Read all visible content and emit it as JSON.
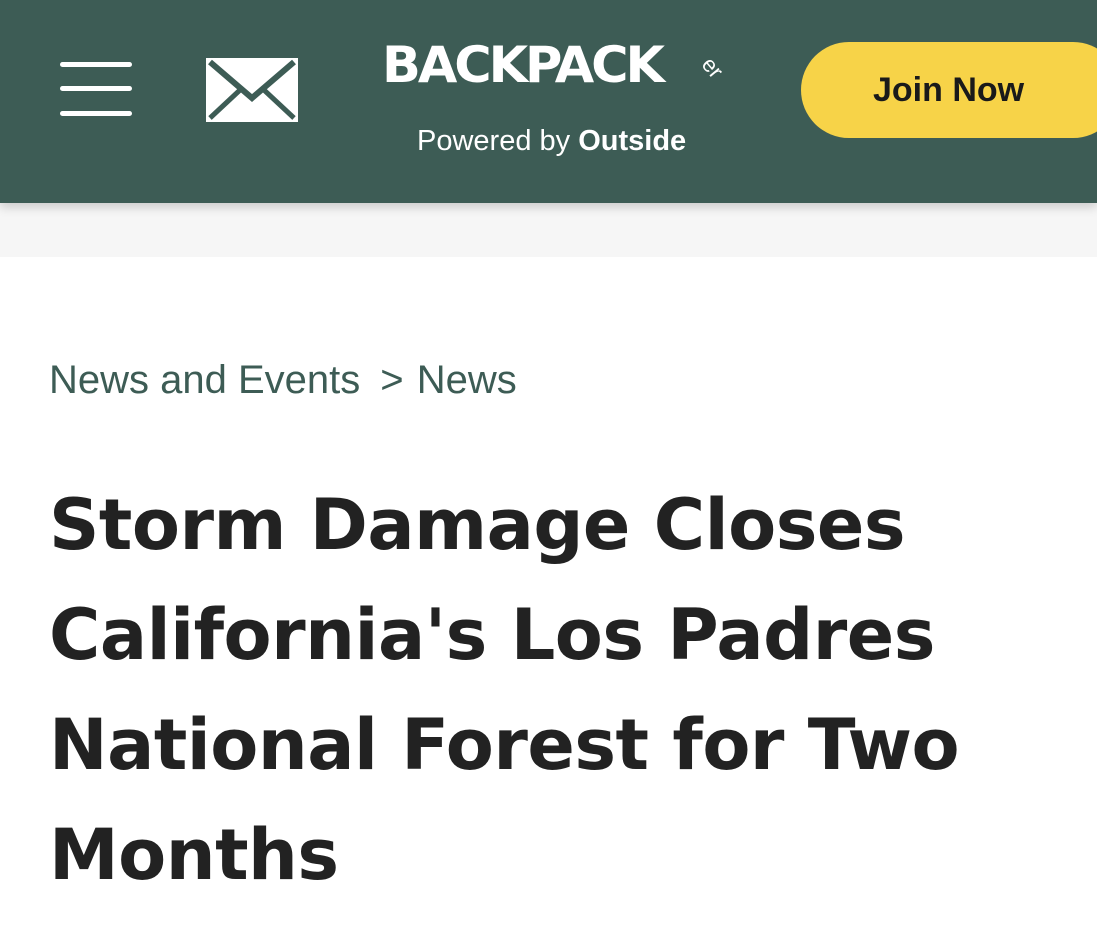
{
  "header": {
    "logo_text": "BACKPACK",
    "logo_suffix": "er",
    "powered_prefix": "Powered by ",
    "powered_brand": "Outside",
    "join_label": "Join Now",
    "menu_icon": "hamburger-menu-icon",
    "mail_icon": "envelope-icon",
    "bg_color": "#3d5c55",
    "join_color": "#f7d348"
  },
  "breadcrumb": {
    "items": [
      "News and Events",
      "News"
    ],
    "separator": ">"
  },
  "article": {
    "title": "Storm Damage Closes California's Los Padres National Forest for Two Months"
  }
}
